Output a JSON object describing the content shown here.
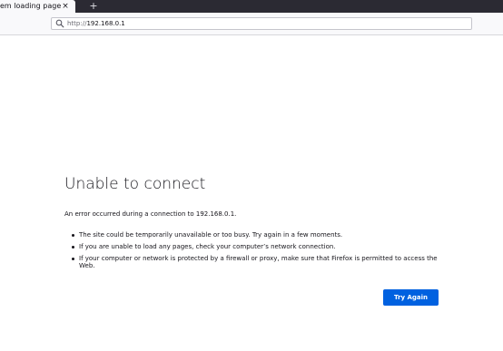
{
  "browser": {
    "tab": {
      "title": "Problem loading page",
      "close_symbol": "×"
    },
    "new_tab_symbol": "+",
    "url_bar": {
      "protocol": "http://",
      "host": "192.168.0.1",
      "icon": "search-icon"
    }
  },
  "error_page": {
    "title": "Unable to connect",
    "description": "An error occurred during a connection to 192.168.0.1.",
    "suggestions": [
      "The site could be temporarily unavailable or too busy. Try again in a few moments.",
      "If you are unable to load any pages, check your computer’s network connection.",
      "If your computer or network is protected by a firewall or proxy, make sure that Firefox is permitted to access the Web."
    ],
    "button_label": "Try Again"
  },
  "colors": {
    "tab_strip": "#2b2a33",
    "primary_button": "#0061e0"
  }
}
